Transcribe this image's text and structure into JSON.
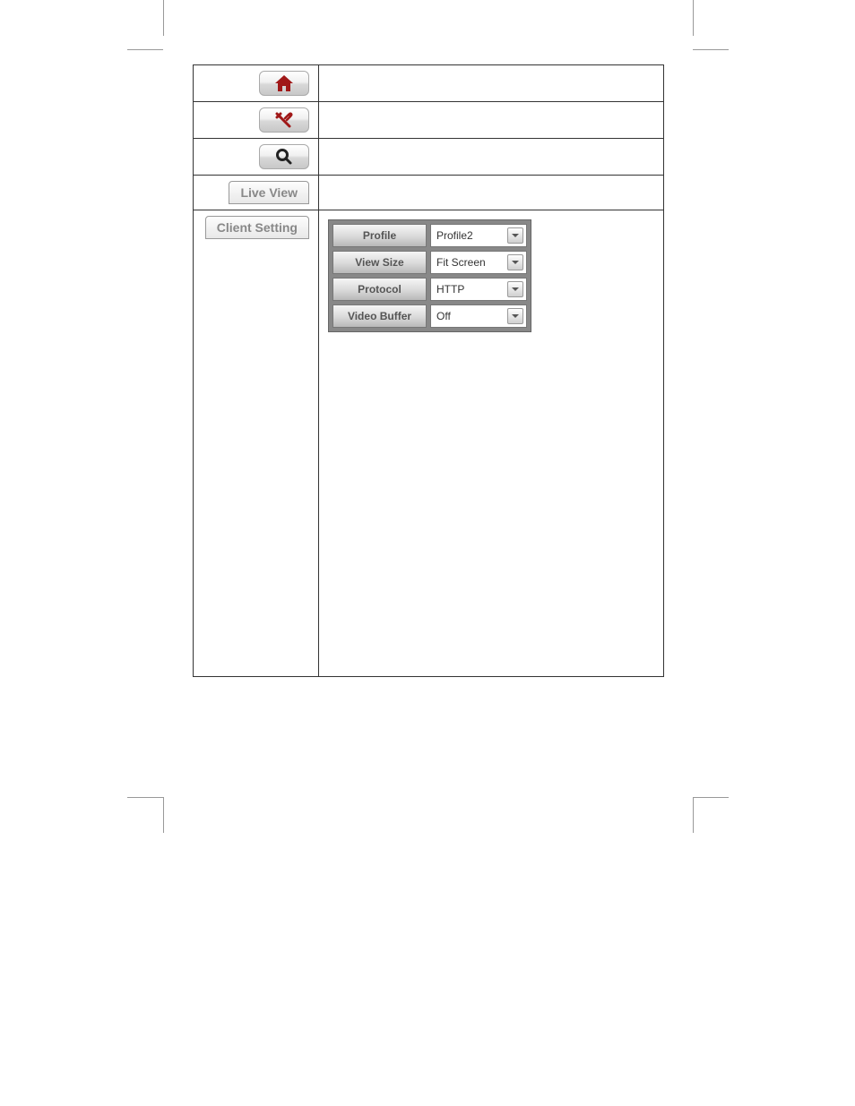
{
  "sidebar": {
    "home_icon": "home",
    "tools_icon": "tools",
    "search_icon": "search",
    "live_view_label": "Live View",
    "client_setting_label": "Client Setting"
  },
  "settings": {
    "profile": {
      "label": "Profile",
      "value": "Profile2"
    },
    "view_size": {
      "label": "View Size",
      "value": "Fit Screen"
    },
    "protocol": {
      "label": "Protocol",
      "value": "HTTP"
    },
    "video_buffer": {
      "label": "Video Buffer",
      "value": "Off"
    }
  },
  "colors": {
    "accent": "#a01818"
  }
}
